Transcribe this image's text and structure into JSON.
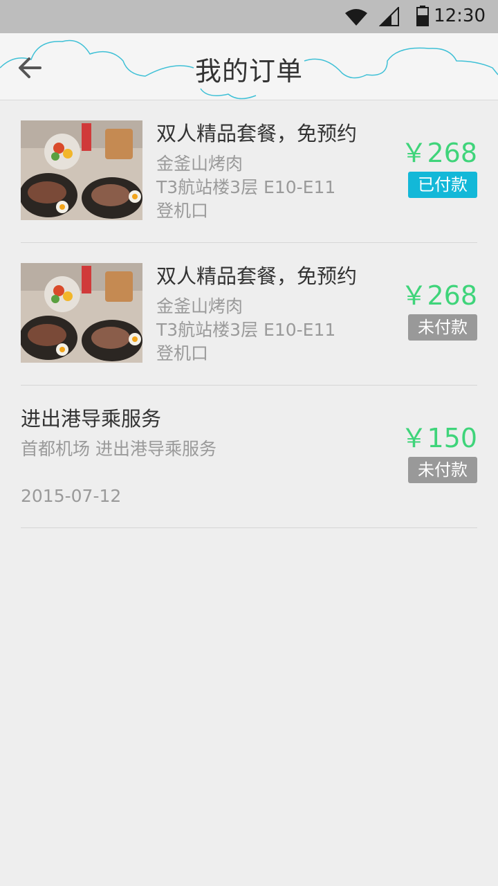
{
  "status_bar": {
    "time": "12:30"
  },
  "header": {
    "title": "我的订单"
  },
  "orders": [
    {
      "name": "双人精品套餐，免预约",
      "shop": "金釜山烤肉",
      "location_line1": "T3航站楼3层  E10-E11",
      "location_line2": "登机口",
      "price": "￥268",
      "status": "已付款",
      "status_color": "#13b8d8"
    },
    {
      "name": "双人精品套餐，免预约",
      "shop": "金釜山烤肉",
      "location_line1": "T3航站楼3层  E10-E11",
      "location_line2": "登机口",
      "price": "￥268",
      "status": "未付款",
      "status_color": "#999999"
    },
    {
      "name": "进出港导乘服务",
      "detail": "首都机场  进出港导乘服务",
      "date": "2015-07-12",
      "price": "￥150",
      "status": "未付款",
      "status_color": "#999999"
    }
  ],
  "colors": {
    "price": "#3fd47a",
    "paid": "#13b8d8",
    "unpaid": "#999999"
  },
  "icons": [
    "wifi-icon",
    "signal-icon",
    "battery-icon",
    "back-arrow-icon",
    "cloud-decoration"
  ]
}
